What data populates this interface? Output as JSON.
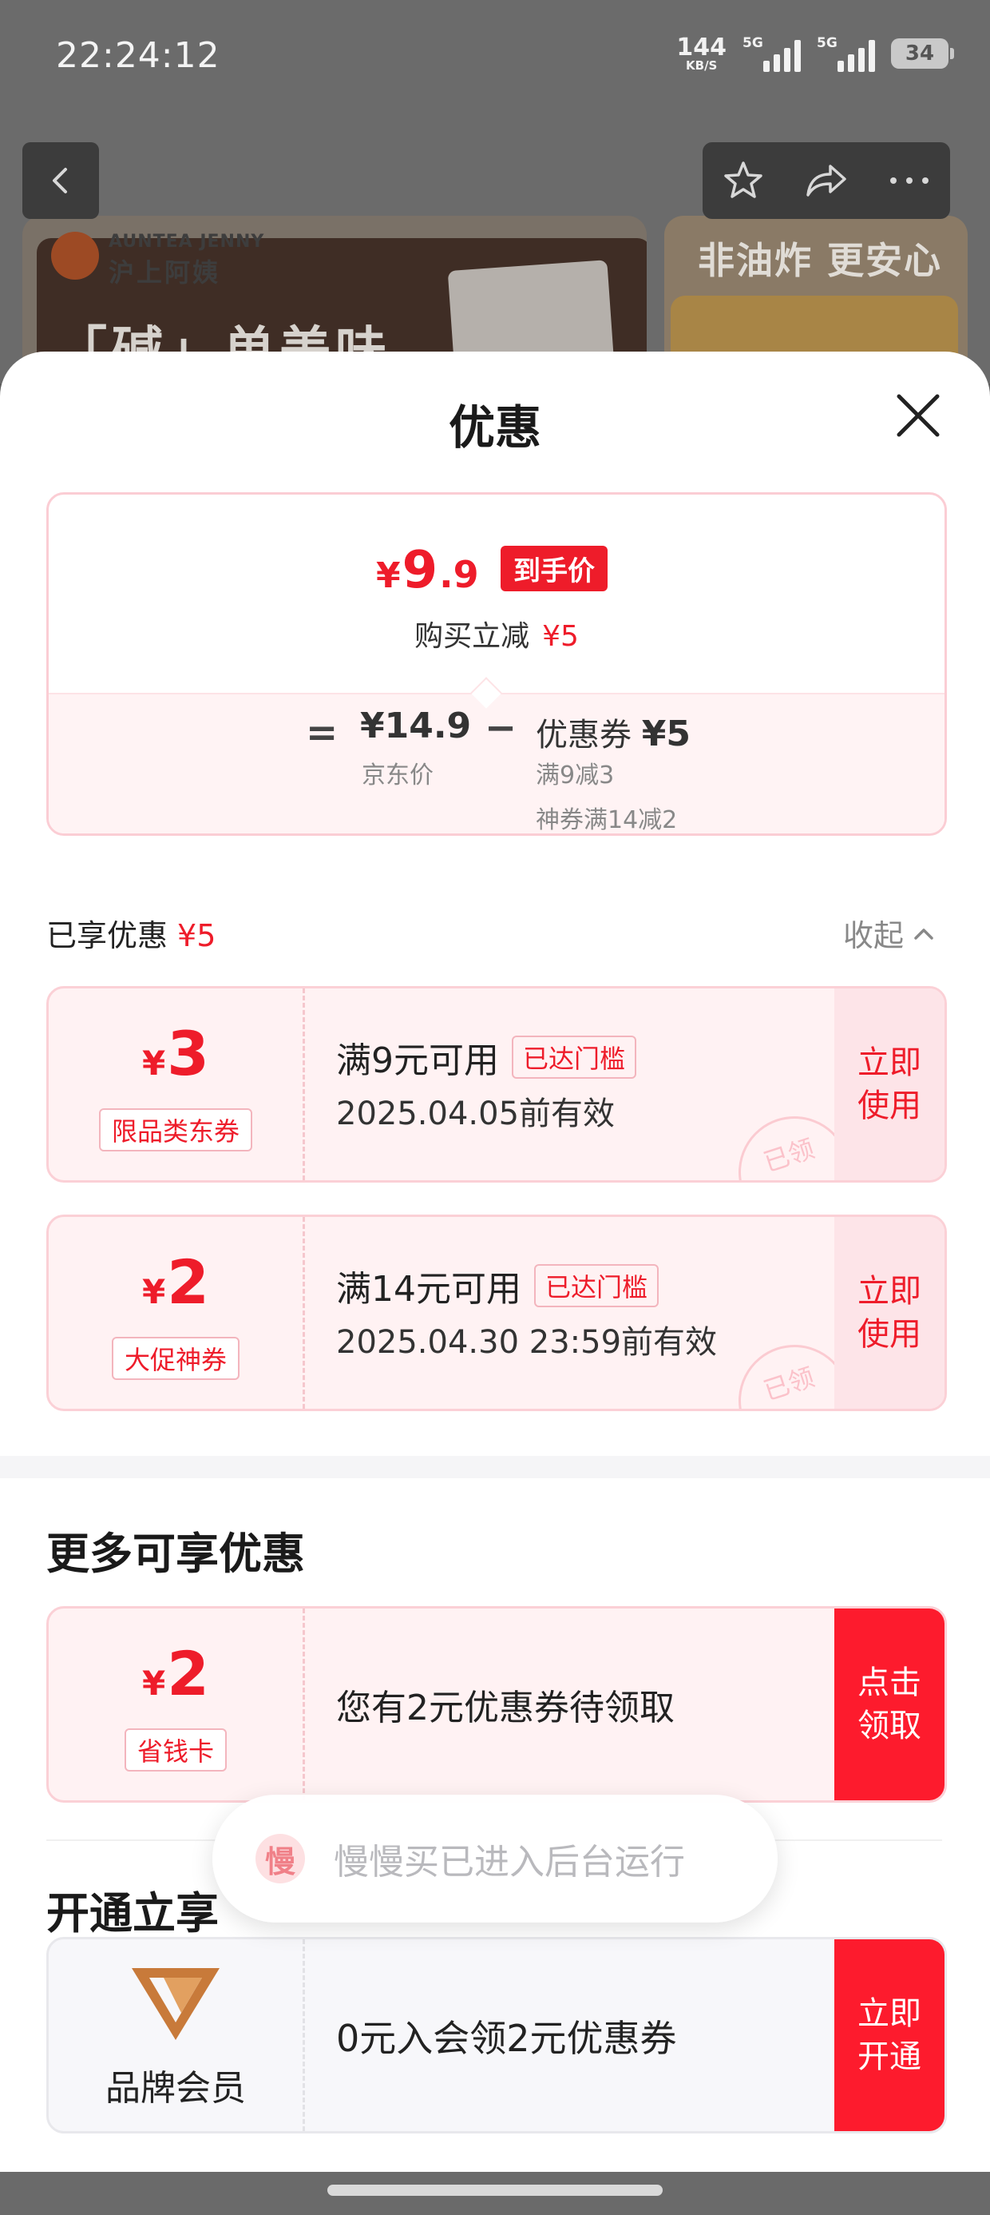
{
  "status_bar": {
    "time": "22:24:12",
    "net_speed": "144",
    "net_unit": "KB/S",
    "signal1_label": "5G",
    "signal2_label": "5G",
    "battery": "34"
  },
  "background": {
    "brand_en": "AUNTEA JENNY",
    "brand_cn": "沪上阿姨",
    "headline": "「碱」单美味",
    "banner_right_text": "非油炸 更安心"
  },
  "sheet": {
    "title": "优惠",
    "price": {
      "currency": "¥",
      "integer": "9",
      "decimal": ".9",
      "tag": "到手价",
      "save_label": "购买立减",
      "save_amount": "¥5"
    },
    "formula": {
      "eq": "=",
      "jd_price": "¥14.9",
      "jd_label": "京东价",
      "minus": "−",
      "coupon_label": "优惠券",
      "coupon_amount": "¥5",
      "coupon_rule1": "满9减3",
      "coupon_rule2": "神券满14减2"
    },
    "enjoyed": {
      "label": "已享优惠",
      "amount": "¥5",
      "collapse": "收起"
    },
    "coupons": [
      {
        "currency": "¥",
        "amount": "3",
        "type": "限品类东券",
        "condition": "满9元可用",
        "badge": "已达门槛",
        "validity": "2025.04.05前有效",
        "button_line1": "立即",
        "button_line2": "使用",
        "stamp": "已领"
      },
      {
        "currency": "¥",
        "amount": "2",
        "type": "大促神券",
        "condition": "满14元可用",
        "badge": "已达门槛",
        "validity": "2025.04.30 23:59前有效",
        "button_line1": "立即",
        "button_line2": "使用",
        "stamp": "已领"
      }
    ],
    "more": {
      "title": "更多可享优惠",
      "card": {
        "currency": "¥",
        "amount": "2",
        "type": "省钱卡",
        "desc": "您有2元优惠券待领取",
        "button_line1": "点击",
        "button_line2": "领取"
      }
    },
    "open": {
      "title": "开通立享",
      "card": {
        "name": "品牌会员",
        "desc": "0元入会领2元优惠券",
        "button_line1": "立即",
        "button_line2": "开通"
      }
    }
  },
  "toast": {
    "icon_char": "慢",
    "text": "慢慢买已进入后台运行"
  },
  "colors": {
    "accent": "#ee1c2a",
    "button_red": "#fd1b2d",
    "coupon_bg": "#fff2f3"
  },
  "icons": [
    "back-icon",
    "star-icon",
    "share-icon",
    "more-icon",
    "close-icon",
    "chevron-up-icon",
    "brand-member-logo"
  ]
}
